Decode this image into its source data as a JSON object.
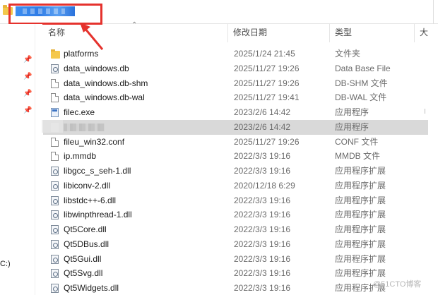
{
  "address_bar": {
    "highlight_color": "#e5322d"
  },
  "columns": {
    "name": "名称",
    "date": "修改日期",
    "type": "类型",
    "size": "大"
  },
  "sidebar": {
    "drive_label": "C:)"
  },
  "files": [
    {
      "name": "platforms",
      "date": "2025/1/24 21:45",
      "type": "文件夹",
      "icon": "folder-icon"
    },
    {
      "name": "data_windows.db",
      "date": "2025/11/27 19:26",
      "type": "Data Base File",
      "icon": "settings-file-icon"
    },
    {
      "name": "data_windows.db-shm",
      "date": "2025/11/27 19:26",
      "type": "DB-SHM 文件",
      "icon": "file-icon"
    },
    {
      "name": "data_windows.db-wal",
      "date": "2025/11/27 19:41",
      "type": "DB-WAL 文件",
      "icon": "file-icon"
    },
    {
      "name": "filec.exe",
      "date": "2023/2/6 14:42",
      "type": "应用程序",
      "icon": "exe-icon"
    },
    {
      "name": "",
      "date": "2023/2/6 14:42",
      "type": "应用程序",
      "icon": "exe-icon",
      "selected": true
    },
    {
      "name": "fileu_win32.conf",
      "date": "2025/11/27 19:26",
      "type": "CONF 文件",
      "icon": "file-icon"
    },
    {
      "name": "ip.mmdb",
      "date": "2022/3/3 19:16",
      "type": "MMDB 文件",
      "icon": "file-icon"
    },
    {
      "name": "libgcc_s_seh-1.dll",
      "date": "2022/3/3 19:16",
      "type": "应用程序扩展",
      "icon": "settings-file-icon"
    },
    {
      "name": "libiconv-2.dll",
      "date": "2020/12/18 6:29",
      "type": "应用程序扩展",
      "icon": "settings-file-icon"
    },
    {
      "name": "libstdc++-6.dll",
      "date": "2022/3/3 19:16",
      "type": "应用程序扩展",
      "icon": "settings-file-icon"
    },
    {
      "name": "libwinpthread-1.dll",
      "date": "2022/3/3 19:16",
      "type": "应用程序扩展",
      "icon": "settings-file-icon"
    },
    {
      "name": "Qt5Core.dll",
      "date": "2022/3/3 19:16",
      "type": "应用程序扩展",
      "icon": "settings-file-icon"
    },
    {
      "name": "Qt5DBus.dll",
      "date": "2022/3/3 19:16",
      "type": "应用程序扩展",
      "icon": "settings-file-icon"
    },
    {
      "name": "Qt5Gui.dll",
      "date": "2022/3/3 19:16",
      "type": "应用程序扩展",
      "icon": "settings-file-icon"
    },
    {
      "name": "Qt5Svg.dll",
      "date": "2022/3/3 19:16",
      "type": "应用程序扩展",
      "icon": "settings-file-icon"
    },
    {
      "name": "Qt5Widgets.dll",
      "date": "2022/3/3 19:16",
      "type": "应用程序扩展",
      "icon": "settings-file-icon"
    }
  ],
  "watermark": "@51CTO博客",
  "icons": [
    "pin-icon",
    "folder-icon",
    "file-icon",
    "settings-file-icon",
    "exe-icon",
    "sort-up-icon"
  ]
}
